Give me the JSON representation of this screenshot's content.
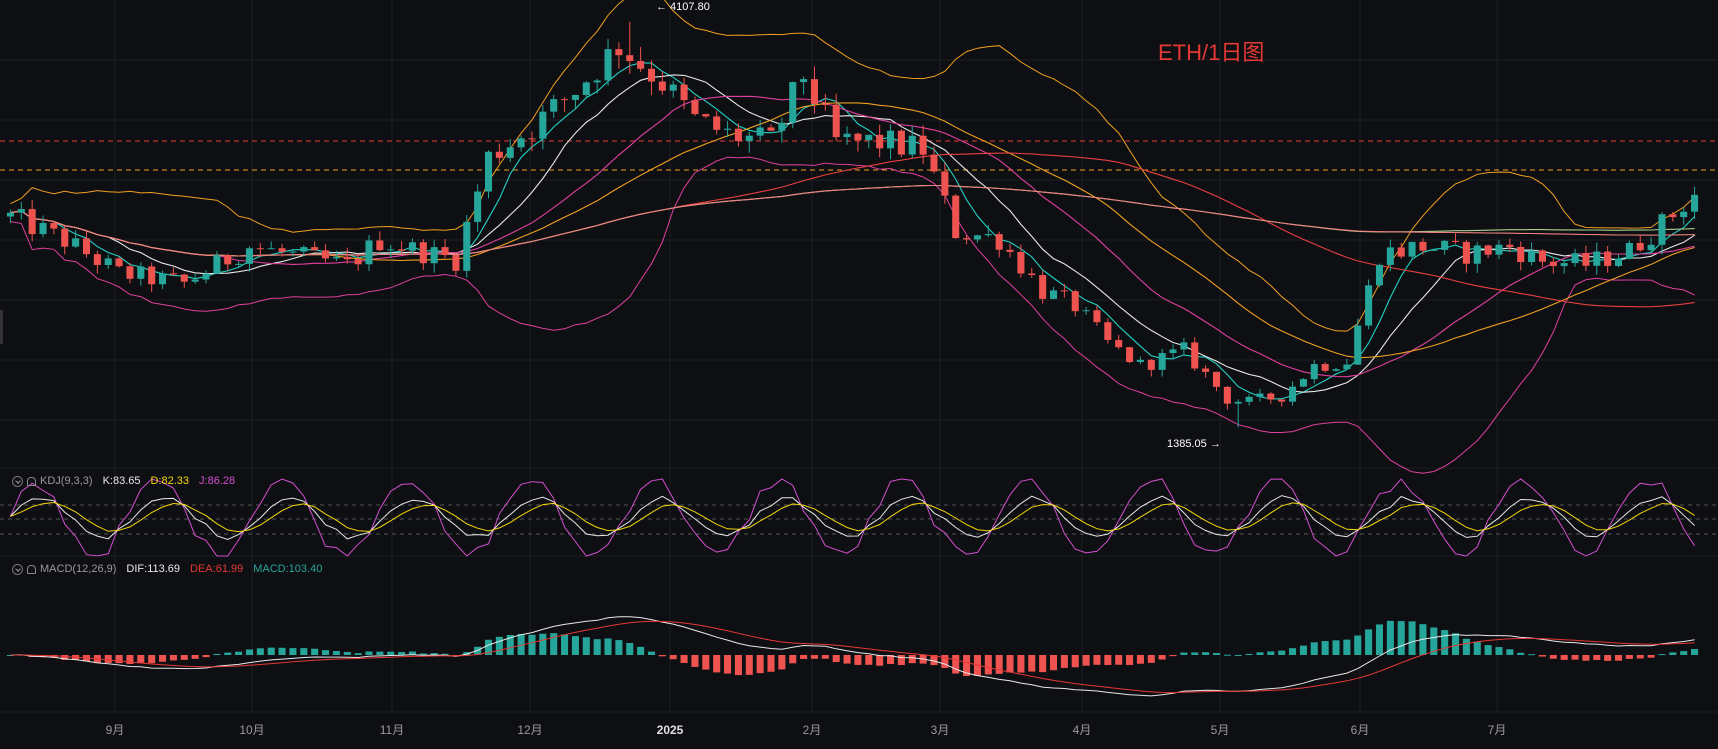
{
  "watermark": "ETH/1日图",
  "colors": {
    "bg": "#0e0f12",
    "grid": "#1d1f24",
    "up": "#26a69a",
    "down": "#ef5350",
    "watermark": "#e53935",
    "ma_white": "#e8e8e8",
    "ma_cyan": "#22d3c5",
    "ma_pink": "#e040a0",
    "ma_orange": "#f0a020",
    "ma_red": "#e84040",
    "ma_green": "#a8d08d",
    "ma_salmon": "#f08080",
    "boll": "#f0a020",
    "kdj_k": "#e8e8e8",
    "kdj_d": "#f5d60a",
    "kdj_j": "#d44fd0",
    "macd_dif": "#e8e8e8",
    "macd_dea": "#e53935"
  },
  "annotations": {
    "high": "← 4107.80",
    "low": "1385.05 →"
  },
  "kdj": {
    "name": "KDJ(9,3,3)",
    "k": "K:83.65",
    "d": "D:82.33",
    "j": "J:86.28"
  },
  "macd": {
    "name": "MACD(12,26,9)",
    "dif": "DIF:113.69",
    "dea": "DEA:61.99",
    "hist": "MACD:103.40"
  },
  "x_axis_labels": [
    "9月",
    "10月",
    "11月",
    "12月",
    "2025",
    "2月",
    "3月",
    "4月",
    "5月",
    "6月",
    "7月"
  ],
  "chart_data": {
    "type": "candlestick",
    "title": "ETH/1日图",
    "price_range": [
      1300,
      4200
    ],
    "high": 4107.8,
    "low": 1385.05,
    "close_price_path": [
      [
        0,
        2800
      ],
      [
        5,
        2640
      ],
      [
        10,
        2420
      ],
      [
        16,
        2350
      ],
      [
        22,
        2600
      ],
      [
        26,
        2540
      ],
      [
        31,
        2470
      ],
      [
        34,
        2640
      ],
      [
        37,
        2580
      ],
      [
        41,
        2510
      ],
      [
        44,
        3200
      ],
      [
        48,
        3400
      ],
      [
        52,
        3650
      ],
      [
        56,
        3950
      ],
      [
        60,
        3700
      ],
      [
        63,
        3450
      ],
      [
        66,
        3350
      ],
      [
        70,
        3300
      ],
      [
        73,
        3750
      ],
      [
        76,
        3300
      ],
      [
        80,
        3300
      ],
      [
        84,
        3250
      ],
      [
        87,
        2700
      ],
      [
        91,
        2650
      ],
      [
        95,
        2300
      ],
      [
        98,
        2200
      ],
      [
        101,
        1950
      ],
      [
        104,
        1800
      ],
      [
        108,
        1900
      ],
      [
        112,
        1580
      ],
      [
        114,
        1550
      ],
      [
        117,
        1600
      ],
      [
        120,
        1800
      ],
      [
        123,
        1830
      ],
      [
        126,
        2550
      ],
      [
        130,
        2600
      ],
      [
        134,
        2550
      ],
      [
        138,
        2600
      ],
      [
        141,
        2500
      ],
      [
        145,
        2480
      ],
      [
        149,
        2570
      ],
      [
        152,
        2750
      ],
      [
        155,
        2950
      ]
    ],
    "kdj_last": {
      "K": 83.65,
      "D": 82.33,
      "J": 86.28
    },
    "macd_last": {
      "DIF": 113.69,
      "DEA": 61.99,
      "MACD": 103.4
    },
    "x_ticks": [
      "9月",
      "10月",
      "11月",
      "12月",
      "2025",
      "2月",
      "3月",
      "4月",
      "5月",
      "6月",
      "7月"
    ]
  }
}
